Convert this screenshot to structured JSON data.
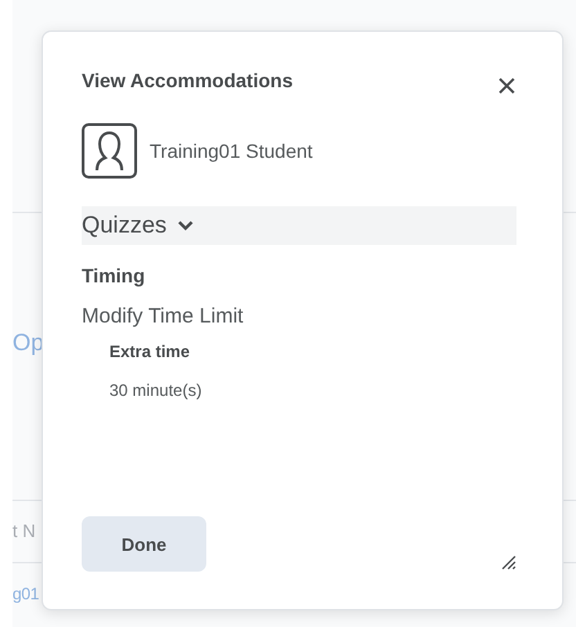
{
  "background": {
    "fragments": [
      {
        "text": "Op",
        "kind": "link"
      },
      {
        "text": "t N",
        "kind": "label"
      },
      {
        "text": "g01",
        "kind": "link"
      }
    ]
  },
  "dialog": {
    "title": "View Accommodations",
    "user": "Training01 Student",
    "section": {
      "title": "Quizzes",
      "expanded": true,
      "heading": "Timing",
      "item": "Modify Time Limit",
      "detail_label": "Extra time",
      "detail_value": "30 minute(s)"
    },
    "buttons": [
      "Done"
    ]
  }
}
